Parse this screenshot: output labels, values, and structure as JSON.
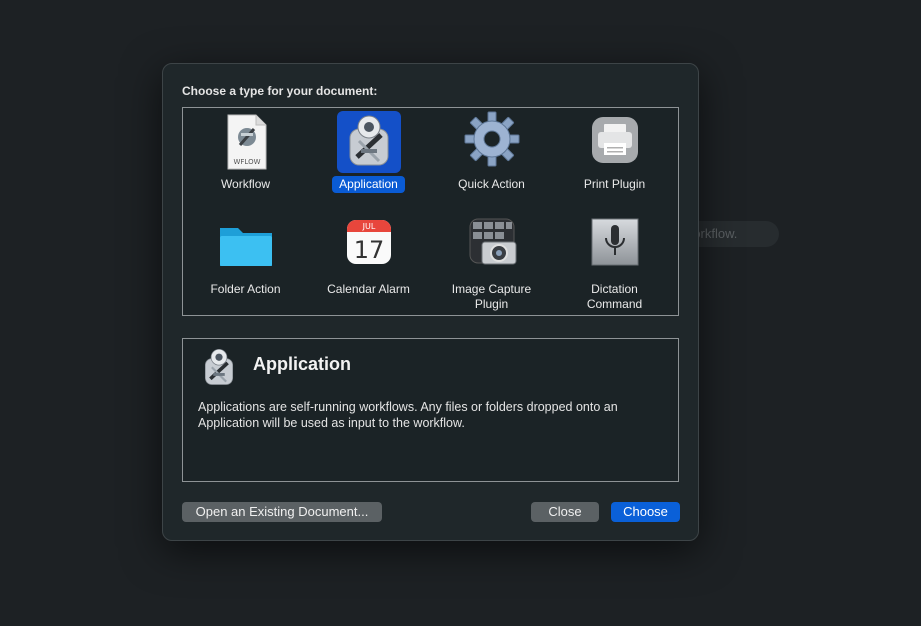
{
  "background": {
    "pill_text": "r workflow."
  },
  "dialog": {
    "prompt": "Choose a type for your document:",
    "types": [
      {
        "label": "Workflow",
        "icon": "workflow-document-icon",
        "file_badge": "WFLOW"
      },
      {
        "label": "Application",
        "icon": "automator-robot-icon",
        "selected": true
      },
      {
        "label": "Quick Action",
        "icon": "gear-icon"
      },
      {
        "label": "Print Plugin",
        "icon": "printer-icon"
      },
      {
        "label": "Folder Action",
        "icon": "folder-icon"
      },
      {
        "label": "Calendar Alarm",
        "icon": "calendar-icon",
        "cal_month": "JUL",
        "cal_day": "17"
      },
      {
        "label": "Image Capture\nPlugin",
        "icon": "camera-icon"
      },
      {
        "label": "Dictation\nCommand",
        "icon": "microphone-icon"
      }
    ],
    "description": {
      "title": "Application",
      "text": "Applications are self-running workflows. Any files or folders dropped onto an Application will be used as input to the workflow."
    },
    "buttons": {
      "open_existing": "Open an Existing Document...",
      "close": "Close",
      "choose": "Choose"
    }
  },
  "colors": {
    "accent": "#0a5bd4",
    "dialog_bg": "#1f272a",
    "page_bg": "#1d2124"
  }
}
